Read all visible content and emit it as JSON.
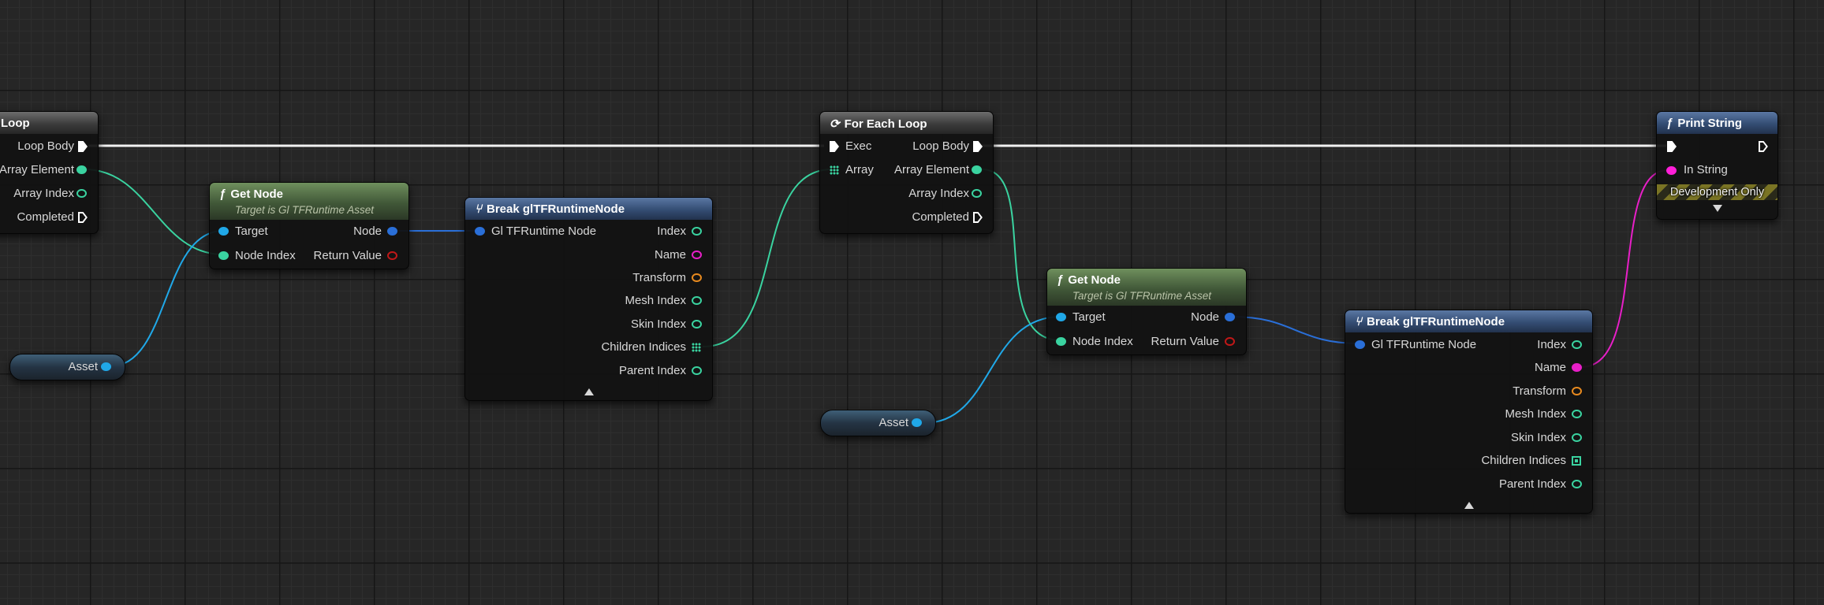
{
  "colors": {
    "exec": "#ffffff",
    "struct_blue": "#2a6fd8",
    "object_blue": "#20a8e8",
    "integer": "#3ad3a0",
    "name_magenta": "#e81fc8",
    "transform": "#e88a1f",
    "string_magenta": "#ff1fd8",
    "return_red": "#c01818"
  },
  "loop_node_left": {
    "title": "Loop",
    "outputs": [
      "Loop Body",
      "Array Element",
      "Array Index",
      "Completed"
    ]
  },
  "get_node_1": {
    "title": "Get Node",
    "subtitle": "Target is Gl TFRuntime Asset",
    "inputs": [
      "Target",
      "Node Index"
    ],
    "outputs": [
      "Node",
      "Return Value"
    ]
  },
  "asset_1": {
    "label": "Asset"
  },
  "break_1": {
    "title": "Break glTFRuntimeNode",
    "input": "Gl TFRuntime Node",
    "outputs": [
      "Index",
      "Name",
      "Transform",
      "Mesh Index",
      "Skin Index",
      "Children Indices",
      "Parent Index"
    ]
  },
  "for_each": {
    "title": "For Each Loop",
    "inputs": [
      "Exec",
      "Array"
    ],
    "outputs": [
      "Loop Body",
      "Array Element",
      "Array Index",
      "Completed"
    ]
  },
  "get_node_2": {
    "title": "Get Node",
    "subtitle": "Target is Gl TFRuntime Asset",
    "inputs": [
      "Target",
      "Node Index"
    ],
    "outputs": [
      "Node",
      "Return Value"
    ]
  },
  "asset_2": {
    "label": "Asset"
  },
  "break_2": {
    "title": "Break glTFRuntimeNode",
    "input": "Gl TFRuntime Node",
    "outputs": [
      "Index",
      "Name",
      "Transform",
      "Mesh Index",
      "Skin Index",
      "Children Indices",
      "Parent Index"
    ]
  },
  "print_string": {
    "title": "Print String",
    "inputs": [
      "In String"
    ],
    "dev_only": "Development Only"
  }
}
